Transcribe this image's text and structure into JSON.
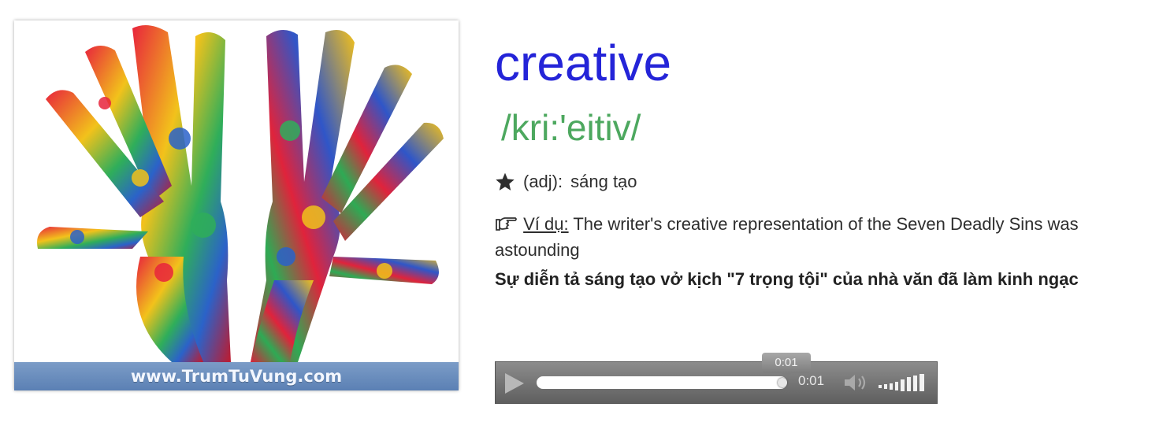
{
  "image": {
    "footer_text": "www.TrumTuVung.com",
    "art_icon": "painted-hands-image"
  },
  "entry": {
    "word": "creative",
    "ipa": "/kri:'eitiv/",
    "pos_icon": "star-icon",
    "pos": "(adj):",
    "meaning": "sáng tạo",
    "example_icon": "pointing-hand-icon",
    "example_label": "Ví dụ:",
    "example_text": "The writer's creative representation of the Seven Deadly Sins was astounding",
    "translation": "Sự diễn tả sáng tạo vở kịch \"7 trọng tội\" của nhà văn đã làm kinh ngạc"
  },
  "player": {
    "tooltip": "0:01",
    "time": "0:01",
    "progress": 1.0,
    "volume_level": 1.0,
    "icons": [
      "play-icon",
      "volume-icon",
      "volume-level-icon"
    ]
  },
  "colors": {
    "word": "#2424d8",
    "ipa": "#4da85f",
    "footer": "#5b80b4",
    "player": "#6f6f6f"
  }
}
